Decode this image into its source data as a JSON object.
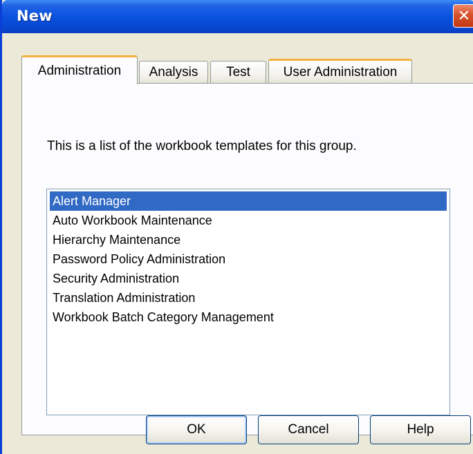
{
  "window": {
    "title": "New",
    "close_glyph": "✕"
  },
  "tabs": [
    {
      "label": "Administration",
      "active": true
    },
    {
      "label": "Analysis",
      "active": false
    },
    {
      "label": "Test",
      "active": false
    },
    {
      "label": "User Administration",
      "active": false
    }
  ],
  "panel": {
    "description": "This is a list of the workbook templates for this group."
  },
  "templates": {
    "items": [
      "Alert Manager",
      "Auto Workbook Maintenance",
      "Hierarchy Maintenance",
      "Password Policy Administration",
      "Security Administration",
      "Translation Administration",
      "Workbook Batch Category Management"
    ],
    "selected_index": 0
  },
  "buttons": {
    "ok": "OK",
    "cancel": "Cancel",
    "help": "Help"
  },
  "colors": {
    "titlebar": "#0a52e0",
    "selection": "#316ac5",
    "tab_highlight": "#f2b13a",
    "close_button": "#d8502c"
  },
  "icons": {
    "close": "close-icon"
  }
}
